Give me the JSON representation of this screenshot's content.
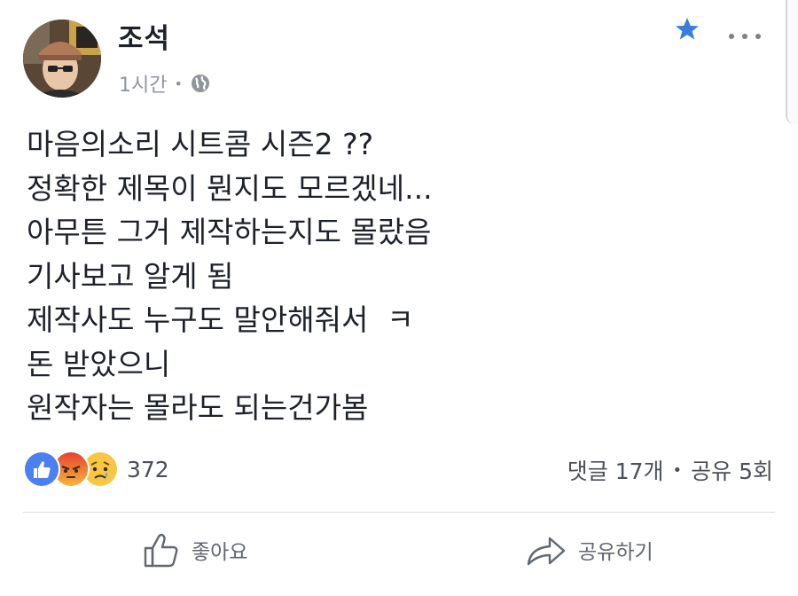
{
  "post": {
    "author": "조석",
    "time": "1시간",
    "meta_separator": "•",
    "lines": [
      "마음의소리 시트콤 시즌2 ??",
      "정확한 제목이 뭔지도 모르겠네...",
      "아무튼 그거 제작하는지도 몰랐음",
      "기사보고 알게 됨",
      "제작사도 누구도 말안해줘서  ㅋ",
      "돈 받았으니",
      "원작자는 몰라도 되는건가봄"
    ]
  },
  "engagement": {
    "reaction_count": "372",
    "comments": "댓글 17개",
    "separator": "•",
    "shares": "공유 5회"
  },
  "actions": {
    "like": "좋아요",
    "share": "공유하기"
  },
  "icons": {
    "star": "star-icon",
    "more": "more-options-icon",
    "globe": "globe-icon",
    "like_reaction": "like-reaction-icon",
    "angry_reaction": "angry-reaction-icon",
    "sad_reaction": "sad-reaction-icon",
    "thumbs_up": "thumbs-up-icon",
    "share_arrow": "share-arrow-icon"
  },
  "colors": {
    "accent_blue": "#4267b2",
    "star_blue": "#3b7ddd",
    "text": "#1d2129",
    "muted": "#90949c",
    "angry": "#e9711c",
    "sad": "#f7c645"
  }
}
